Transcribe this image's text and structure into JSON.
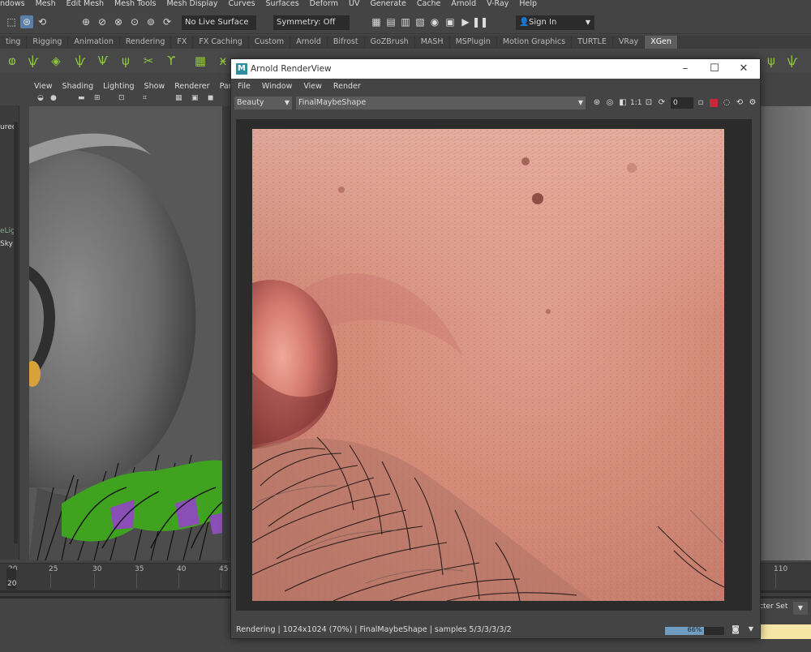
{
  "menubar": [
    "ndows",
    "Mesh",
    "Edit Mesh",
    "Mesh Tools",
    "Mesh Display",
    "Curves",
    "Surfaces",
    "Deform",
    "UV",
    "Generate",
    "Cache",
    "Arnold",
    "V-Ray",
    "Help"
  ],
  "statusline": {
    "live_surface": "No Live Surface",
    "symmetry": "Symmetry: Off",
    "sign_in": "Sign In"
  },
  "shelf_tabs": [
    "ting",
    "Rigging",
    "Animation",
    "Rendering",
    "FX",
    "FX Caching",
    "Custom",
    "Arnold",
    "Bifrost",
    "GoZBrush",
    "MASH",
    "MSPlugin",
    "Motion Graphics",
    "TURTLE",
    "VRay",
    "XGen"
  ],
  "shelf_selected": "XGen",
  "left_strip": {
    "item1": "urec",
    "item2": "eLig",
    "item3": "Sky"
  },
  "viewport_menu": [
    "View",
    "Shading",
    "Lighting",
    "Show",
    "Renderer",
    "Panels"
  ],
  "timeline": {
    "ticks": [
      "20",
      "25",
      "30",
      "35",
      "40",
      "45",
      "110"
    ],
    "current_frame": "20"
  },
  "character_set": "cter Set",
  "renderview": {
    "title": "Arnold RenderView",
    "logo_letter": "M",
    "menu": [
      "File",
      "Window",
      "View",
      "Render"
    ],
    "aov": "Beauty",
    "camera": "FinalMaybeShape",
    "ratio_label": "1:1",
    "exposure_value": "0",
    "status": "Rendering | 1024x1024 (70%) | FinalMaybeShape | samples 5/3/3/3/3/2",
    "progress": 0.66,
    "progress_label": "66%"
  },
  "colors": {
    "maya_bg": "#444444",
    "accent_blue": "#5a7fa8",
    "shelf_icon_green": "#8ec63f",
    "stop_red": "#c8283a",
    "skin": "#d58f7e"
  }
}
